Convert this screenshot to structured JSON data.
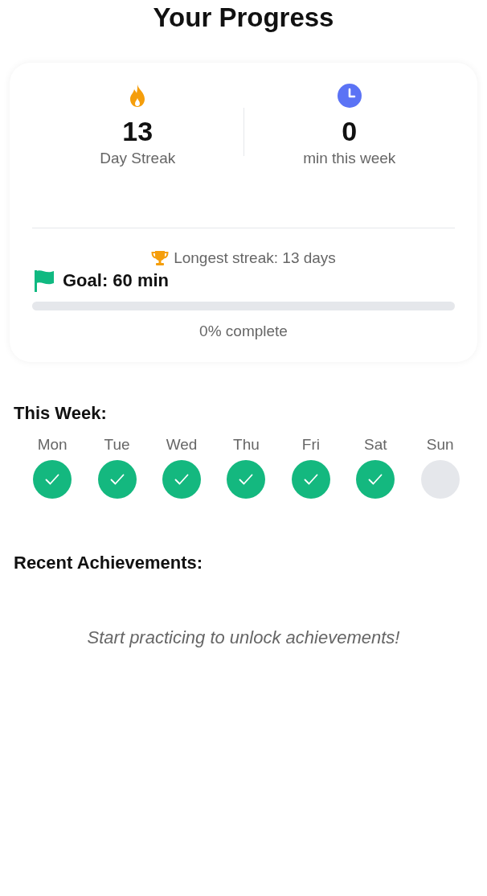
{
  "title": "Your Progress",
  "stats": [
    {
      "kind": "streak",
      "value": "13",
      "label": "Day Streak"
    },
    {
      "kind": "time",
      "value": "0",
      "label": "min this week"
    }
  ],
  "longest_streak": "Longest streak: 13 days",
  "goal": {
    "label": "Goal: 60 min",
    "level": 0,
    "reading": "0% complete"
  },
  "week": {
    "heading": "This Week:",
    "days": [
      {
        "label": "Mon",
        "done": true
      },
      {
        "label": "Tue",
        "done": true
      },
      {
        "label": "Wed",
        "done": true
      },
      {
        "label": "Thu",
        "done": true
      },
      {
        "label": "Fri",
        "done": true
      },
      {
        "label": "Sat",
        "done": true
      },
      {
        "label": "Sun",
        "done": false
      }
    ]
  },
  "achievements": {
    "heading": "Recent Achievements:",
    "empty_message": "Start practicing to unlock achievements!"
  }
}
